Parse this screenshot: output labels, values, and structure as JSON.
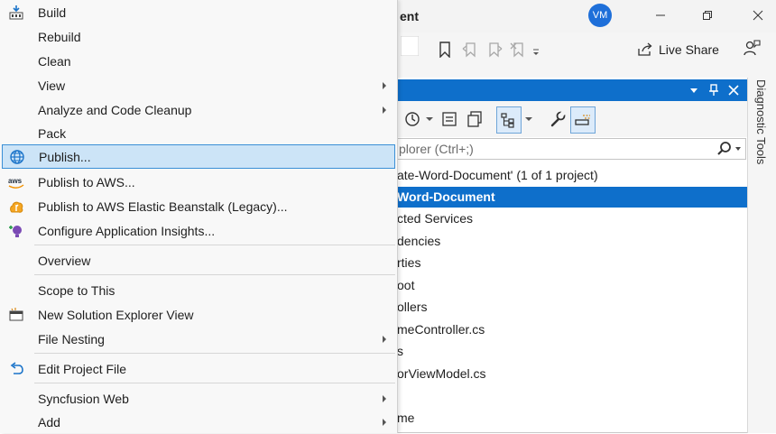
{
  "window": {
    "title_fragment": "ent",
    "avatar_initials": "VM"
  },
  "toolbar": {
    "live_share_label": "Live Share"
  },
  "solution_explorer": {
    "search_placeholder": "plorer (Ctrl+;)",
    "side_tab_label": "Diagnostic Tools",
    "tree": [
      {
        "text": "ate-Word-Document' (1 of 1 project)",
        "selected": false
      },
      {
        "text": "Word-Document",
        "selected": true
      },
      {
        "text": "cted Services",
        "selected": false
      },
      {
        "text": "dencies",
        "selected": false
      },
      {
        "text": "rties",
        "selected": false
      },
      {
        "text": "oot",
        "selected": false
      },
      {
        "text": "ollers",
        "selected": false
      },
      {
        "text": "meController.cs",
        "selected": false
      },
      {
        "text": "s",
        "selected": false
      },
      {
        "text": "orViewModel.cs",
        "selected": false
      },
      {
        "text": "",
        "selected": false
      },
      {
        "text": "me",
        "selected": false
      }
    ]
  },
  "menu": {
    "items": [
      {
        "label": "Build",
        "icon": "build-icon",
        "submenu": false,
        "highlighted": false
      },
      {
        "label": "Rebuild",
        "icon": "",
        "submenu": false,
        "highlighted": false
      },
      {
        "label": "Clean",
        "icon": "",
        "submenu": false,
        "highlighted": false
      },
      {
        "label": "View",
        "icon": "",
        "submenu": true,
        "highlighted": false
      },
      {
        "label": "Analyze and Code Cleanup",
        "icon": "",
        "submenu": true,
        "highlighted": false
      },
      {
        "label": "Pack",
        "icon": "",
        "submenu": false,
        "highlighted": false
      },
      {
        "label": "Publish...",
        "icon": "globe-icon",
        "submenu": false,
        "highlighted": true
      },
      {
        "label": "Publish to AWS...",
        "icon": "aws-icon",
        "submenu": false,
        "highlighted": false
      },
      {
        "label": "Publish to AWS Elastic Beanstalk (Legacy)...",
        "icon": "beanstalk-icon",
        "submenu": false,
        "highlighted": false
      },
      {
        "label": "Configure Application Insights...",
        "icon": "insights-icon",
        "submenu": false,
        "highlighted": false
      },
      {
        "label": "Overview",
        "icon": "",
        "submenu": false,
        "highlighted": false
      },
      {
        "label": "Scope to This",
        "icon": "",
        "submenu": false,
        "highlighted": false
      },
      {
        "label": "New Solution Explorer View",
        "icon": "new-view-icon",
        "submenu": false,
        "highlighted": false
      },
      {
        "label": "File Nesting",
        "icon": "",
        "submenu": true,
        "highlighted": false
      },
      {
        "label": "Edit Project File",
        "icon": "undo-arrow-icon",
        "submenu": false,
        "highlighted": false
      },
      {
        "label": "Syncfusion Web",
        "icon": "",
        "submenu": true,
        "highlighted": false
      },
      {
        "label": "Add",
        "icon": "",
        "submenu": true,
        "highlighted": false
      }
    ]
  },
  "colors": {
    "accent": "#0e6fcb",
    "menu_highlight": "#cce4f7",
    "menu_highlight_border": "#3a8fd6"
  }
}
